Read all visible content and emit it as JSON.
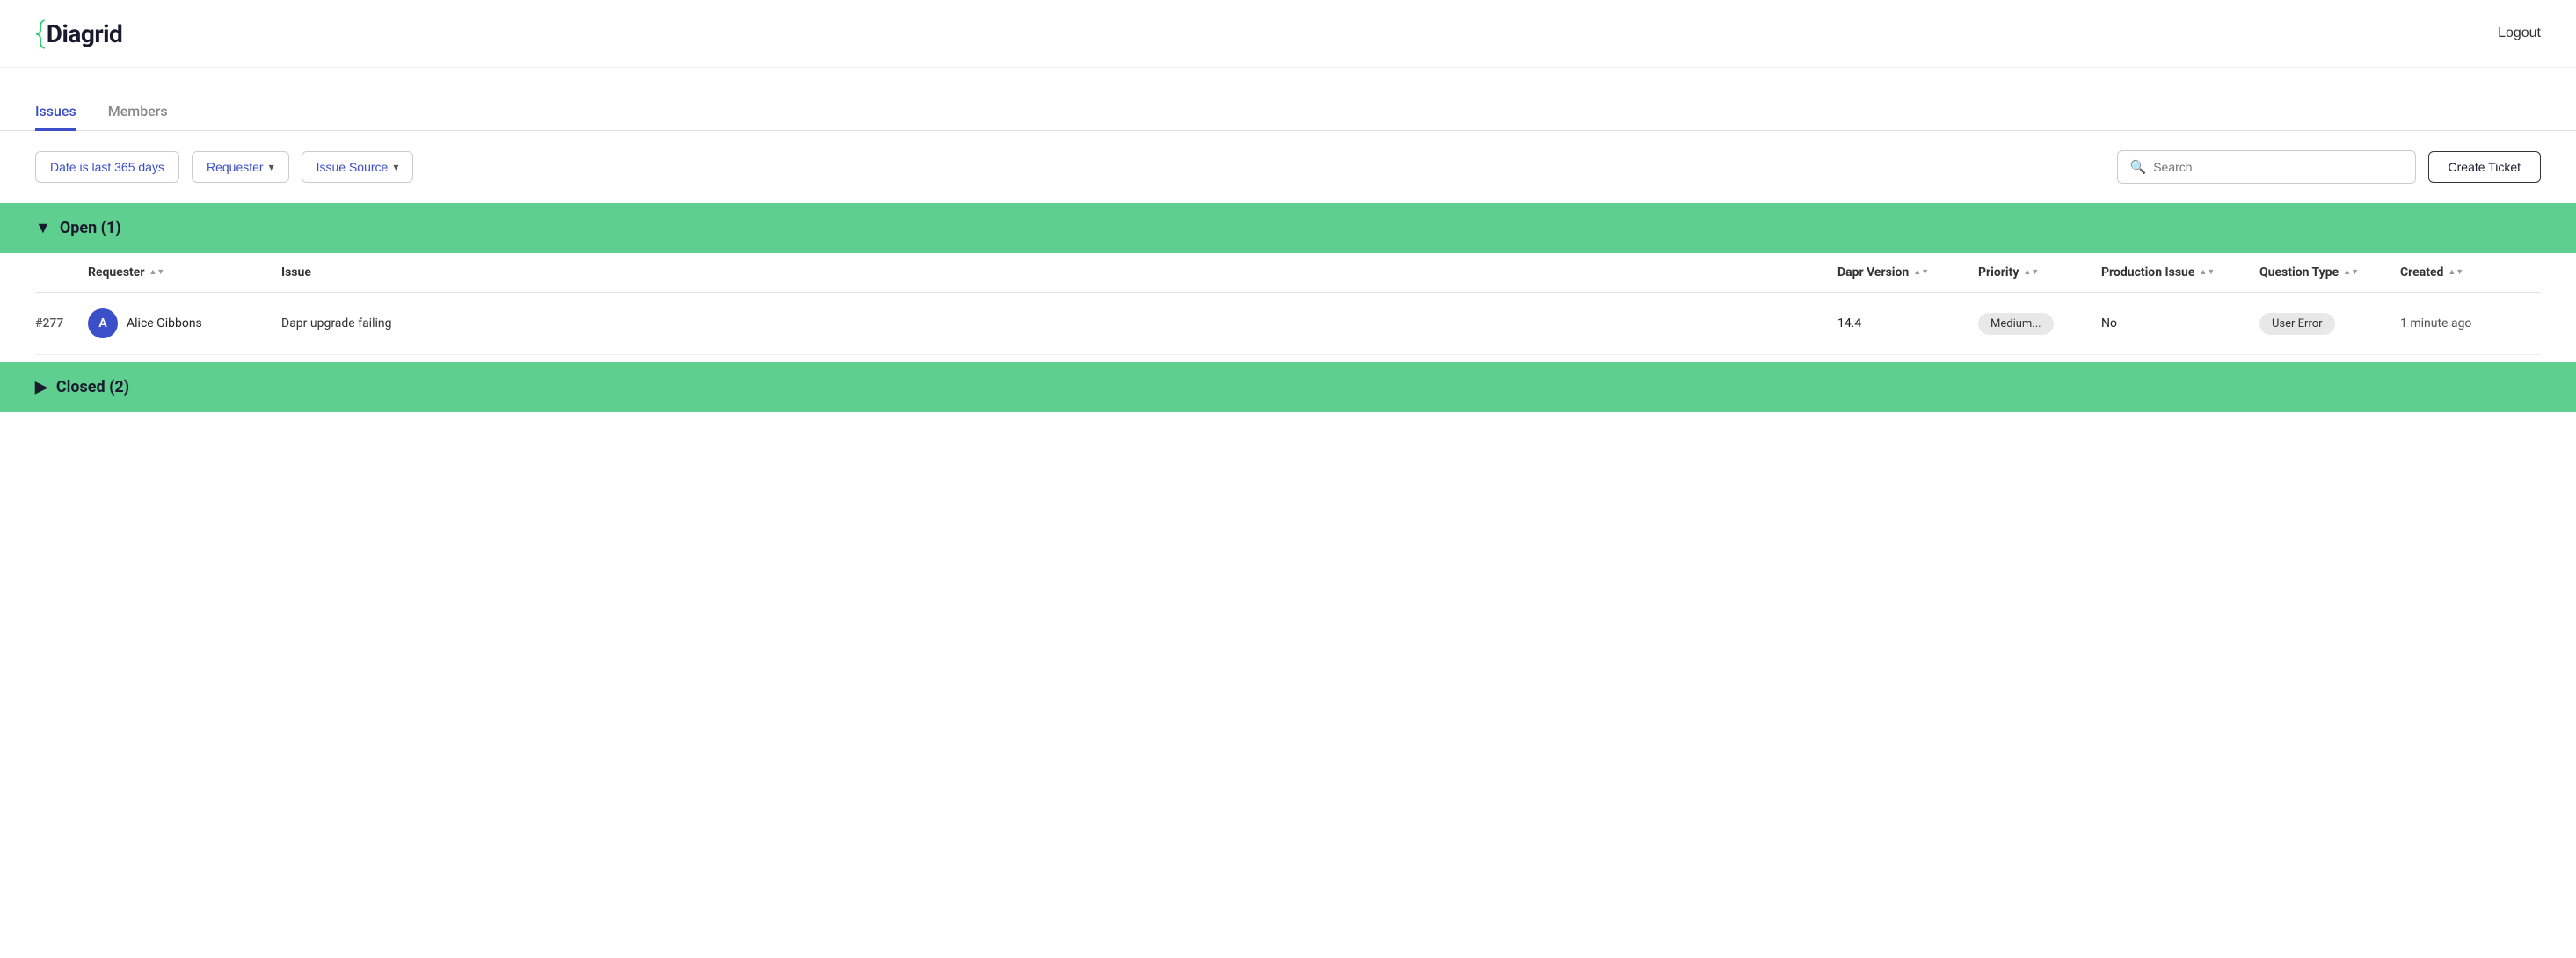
{
  "header": {
    "logo_bracket": "{",
    "logo_text": "Diagrid",
    "logout_label": "Logout"
  },
  "tabs": [
    {
      "label": "Issues",
      "active": true
    },
    {
      "label": "Members",
      "active": false
    }
  ],
  "toolbar": {
    "date_filter_label": "Date is last 365 days",
    "requester_label": "Requester",
    "issue_source_label": "Issue Source",
    "search_placeholder": "Search",
    "create_button_label": "Create Ticket"
  },
  "sections": [
    {
      "id": "open",
      "label": "Open (1)",
      "expanded": true,
      "toggle_icon": "▼"
    },
    {
      "id": "closed",
      "label": "Closed (2)",
      "expanded": false,
      "toggle_icon": "▶"
    }
  ],
  "table": {
    "columns": [
      {
        "label": "",
        "key": "id_col"
      },
      {
        "label": "Requester",
        "key": "requester"
      },
      {
        "label": "Issue",
        "key": "issue"
      },
      {
        "label": "Dapr Version",
        "key": "dapr_version"
      },
      {
        "label": "Priority",
        "key": "priority"
      },
      {
        "label": "Production Issue",
        "key": "production_issue"
      },
      {
        "label": "Question Type",
        "key": "question_type"
      },
      {
        "label": "Created",
        "key": "created"
      }
    ],
    "rows": [
      {
        "ticket_id": "#277",
        "requester_initial": "A",
        "requester_name": "Alice Gibbons",
        "issue": "Dapr upgrade failing",
        "dapr_version": "14.4",
        "priority": "Medium...",
        "production_issue": "No",
        "question_type": "User Error",
        "created": "1 minute ago"
      }
    ]
  }
}
